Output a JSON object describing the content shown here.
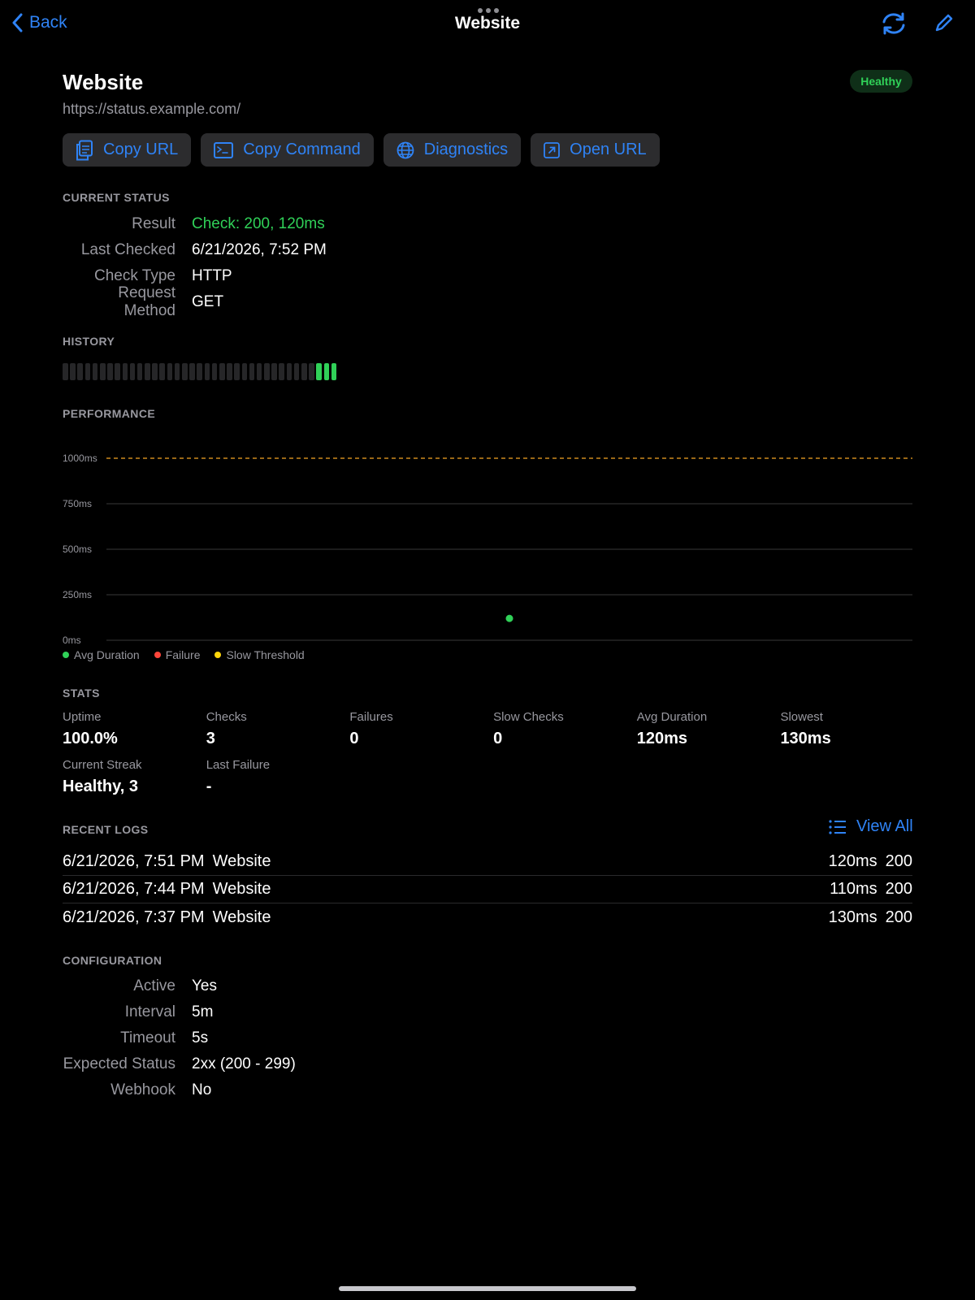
{
  "nav": {
    "back_label": "Back",
    "title": "Website"
  },
  "header": {
    "title": "Website",
    "url": "https://status.example.com/",
    "status_badge": "Healthy"
  },
  "actions": [
    {
      "label": "Copy URL",
      "icon": "document-copy-icon"
    },
    {
      "label": "Copy Command",
      "icon": "terminal-icon"
    },
    {
      "label": "Diagnostics",
      "icon": "globe-icon"
    },
    {
      "label": "Open URL",
      "icon": "open-external-icon"
    }
  ],
  "current_status": {
    "section_title": "CURRENT STATUS",
    "rows": [
      {
        "key": "Result",
        "value": "Check: 200, 120ms"
      },
      {
        "key": "Last Checked",
        "value": "6/21/2026, 7:52 PM"
      },
      {
        "key": "Check Type",
        "value": "HTTP"
      },
      {
        "key": "Request Method",
        "value": "GET"
      }
    ]
  },
  "history": {
    "section_title": "HISTORY",
    "total_slots": 37,
    "healthy_checks": 3
  },
  "performance": {
    "section_title": "PERFORMANCE",
    "legend": [
      {
        "label": "Avg Duration",
        "color": "#30d158"
      },
      {
        "label": "Failure",
        "color": "#ff453a"
      },
      {
        "label": "Slow Threshold",
        "color": "#ffd60a"
      }
    ]
  },
  "chart_data": {
    "type": "scatter",
    "title": "",
    "xlabel": "",
    "ylabel": "",
    "ylim": [
      0,
      1000
    ],
    "y_ticks": [
      "1000ms",
      "750ms",
      "500ms",
      "250ms",
      "0ms"
    ],
    "y_tick_values": [
      1000,
      750,
      500,
      250,
      0
    ],
    "threshold": {
      "name": "Slow Threshold",
      "value": 1000,
      "style": "dashed",
      "color": "#f5a524"
    },
    "series": [
      {
        "name": "Avg Duration",
        "color": "#30d158",
        "points": [
          {
            "x": 0.5,
            "y": 120
          }
        ]
      }
    ],
    "xlim": [
      0,
      1
    ],
    "grid": true,
    "legend_position": "bottom-left"
  },
  "stats": {
    "section_title": "STATS",
    "items": [
      {
        "label": "Uptime",
        "value": "100.0%"
      },
      {
        "label": "Checks",
        "value": "3"
      },
      {
        "label": "Failures",
        "value": "0"
      },
      {
        "label": "Slow Checks",
        "value": "0"
      },
      {
        "label": "Avg Duration",
        "value": "120ms"
      },
      {
        "label": "Slowest",
        "value": "130ms"
      },
      {
        "label": "Current Streak",
        "value": "Healthy, 3"
      },
      {
        "label": "Last Failure",
        "value": "-"
      }
    ]
  },
  "recent_logs": {
    "section_title": "RECENT LOGS",
    "view_all_label": "View All",
    "rows": [
      {
        "time": "6/21/2026, 7:51 PM",
        "name": "Website",
        "duration": "120ms",
        "status": "200"
      },
      {
        "time": "6/21/2026, 7:44 PM",
        "name": "Website",
        "duration": "110ms",
        "status": "200"
      },
      {
        "time": "6/21/2026, 7:37 PM",
        "name": "Website",
        "duration": "130ms",
        "status": "200"
      }
    ]
  },
  "configuration": {
    "section_title": "CONFIGURATION",
    "rows": [
      {
        "key": "Active",
        "value": "Yes"
      },
      {
        "key": "Interval",
        "value": "5m"
      },
      {
        "key": "Timeout",
        "value": "5s"
      },
      {
        "key": "Expected Status",
        "value": "2xx (200 - 299)"
      },
      {
        "key": "Webhook",
        "value": "No"
      }
    ]
  },
  "colors": {
    "accent": "#2f83f6",
    "healthy": "#30d158",
    "background": "#000000"
  }
}
